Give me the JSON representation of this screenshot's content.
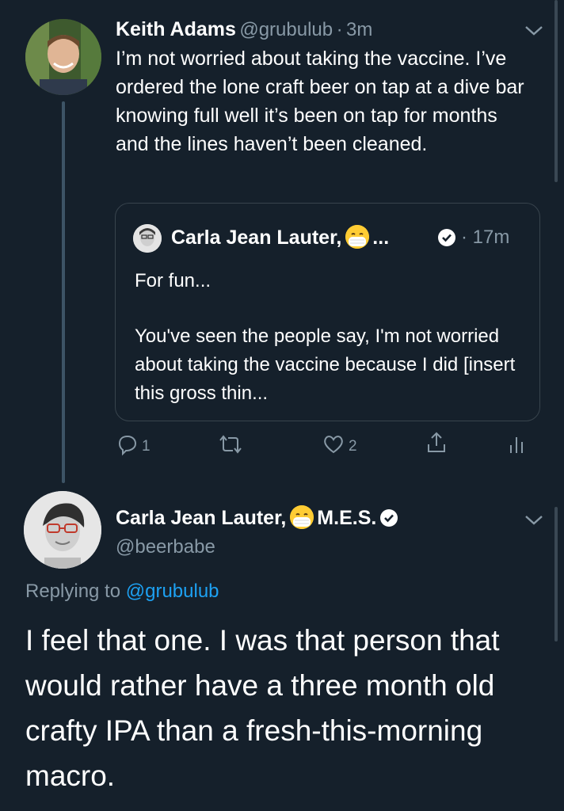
{
  "tweet1": {
    "display_name": "Keith Adams",
    "handle": "@grubulub",
    "time": "3m",
    "text": "I’m not worried about taking the vaccine. I’ve ordered the lone craft beer on tap at a dive bar knowing full well it’s been on tap for months and the lines haven’t been cleaned.",
    "quote": {
      "display_name": "Carla Jean Lauter,",
      "ellipsis": "...",
      "time": "17m",
      "line1": "For fun...",
      "line2": "You've seen the people say, I'm not worried about taking the vaccine because I did [insert this gross thin..."
    },
    "actions": {
      "reply_count": "1",
      "like_count": "2"
    }
  },
  "tweet2": {
    "display_name": "Carla Jean Lauter,",
    "name_suffix": "M.E.S.",
    "handle": "@beerbabe",
    "replying_prefix": "Replying to",
    "replying_handle": "@grubulub",
    "text": "I feel that one. I was that person that would rather have a three month old crafty IPA than a fresh-this-morning macro."
  },
  "icons": {
    "chevron": "chevron-down-icon",
    "verified": "verified-badge-icon",
    "mask_emoji": "face-with-medical-mask-emoji",
    "reply": "reply-icon",
    "retweet": "retweet-icon",
    "like": "heart-icon",
    "share": "share-icon",
    "analytics": "analytics-icon"
  },
  "colors": {
    "background": "#15202b",
    "text": "#ffffff",
    "muted": "#8899a6",
    "link": "#1da1f2",
    "border": "#38444d"
  }
}
